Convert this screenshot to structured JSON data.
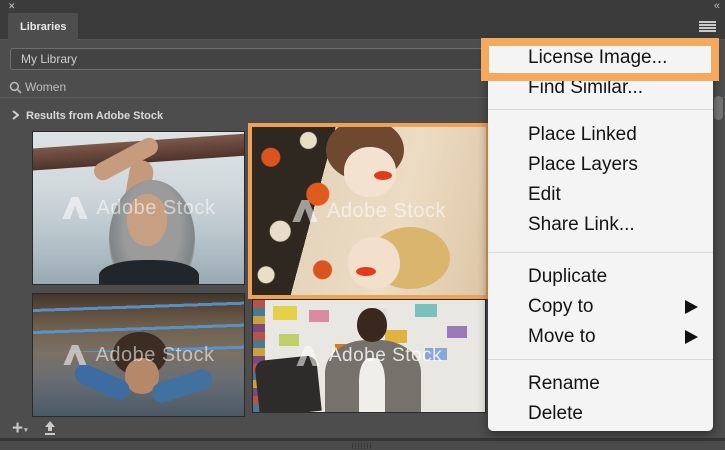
{
  "panel": {
    "tab_label": "Libraries",
    "library_selector": "My Library",
    "search_value": "Women",
    "results_header": "Results from Adobe Stock",
    "watermark": "Adobe Stock"
  },
  "icons": {
    "close": "✕",
    "collapse": "«",
    "panel_menu": "hamburger-icon",
    "search": "magnifier-icon",
    "results_chevron": "chevron-right-icon",
    "add": "+",
    "add_caret": "▾",
    "upload": "upload-icon",
    "submenu_arrow": "triangle-right"
  },
  "thumbnails": [
    {
      "desc": "woman with gray hair carrying surfboard at beach",
      "watermark": "Adobe Stock",
      "selected": false
    },
    {
      "desc": "two retro women lying on floral fabric with red lipstick",
      "watermark": "Adobe Stock",
      "selected": true
    },
    {
      "desc": "woman crawling under wires in mud obstacle race",
      "watermark": "Adobe Stock",
      "selected": false
    },
    {
      "desc": "woman at desk in front of color swatch wall",
      "watermark": "Adobe Stock",
      "selected": false
    }
  ],
  "context_menu": {
    "groups": [
      {
        "items": [
          {
            "label": "License Image...",
            "highlighted": true,
            "submenu": false
          },
          {
            "label": "Find Similar...",
            "highlighted": false,
            "submenu": false
          }
        ]
      },
      {
        "items": [
          {
            "label": "Place Linked",
            "highlighted": false,
            "submenu": false
          },
          {
            "label": "Place Layers",
            "highlighted": false,
            "submenu": false
          },
          {
            "label": "Edit",
            "highlighted": false,
            "submenu": false
          },
          {
            "label": "Share Link...",
            "highlighted": false,
            "submenu": false
          }
        ]
      },
      {
        "items": [
          {
            "label": "Duplicate",
            "highlighted": false,
            "submenu": false
          },
          {
            "label": "Copy to",
            "highlighted": false,
            "submenu": true
          },
          {
            "label": "Move to",
            "highlighted": false,
            "submenu": true
          }
        ]
      },
      {
        "items": [
          {
            "label": "Rename",
            "highlighted": false,
            "submenu": false
          },
          {
            "label": "Delete",
            "highlighted": false,
            "submenu": false
          }
        ]
      }
    ]
  },
  "colors": {
    "highlight_orange": "#F5A95C",
    "selection_orange": "#F0A254",
    "menu_bg": "#F4F4F4",
    "panel_bg": "#4D4D4D",
    "chrome_bg": "#3B3B3B"
  }
}
